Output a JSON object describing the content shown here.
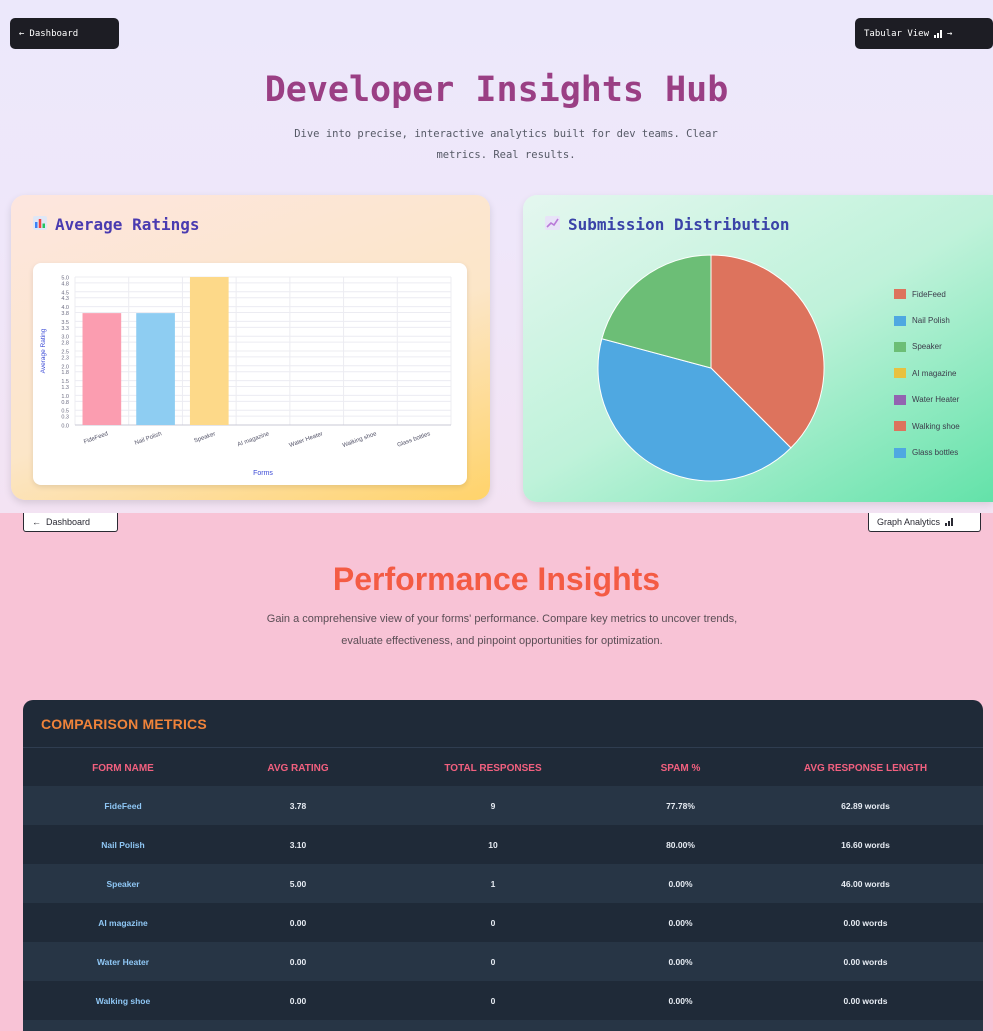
{
  "top": {
    "dashboard_btn": "Dashboard",
    "tabular_btn": "Tabular View",
    "title": "Developer Insights Hub",
    "subtitle": "Dive into precise, interactive analytics built for dev teams. Clear metrics. Real results."
  },
  "ratings_card": {
    "title": "Average Ratings",
    "icon": "bar-chart-icon"
  },
  "dist_card": {
    "title": "Submission Distribution",
    "icon": "trend-chart-icon"
  },
  "chart_data": [
    {
      "type": "bar",
      "categories": [
        "FideFeed",
        "Nail Polish",
        "Speaker",
        "AI magazine",
        "Water Heater",
        "Walking shoe",
        "Glass bottles"
      ],
      "values": [
        3.78,
        3.78,
        5.0,
        0,
        0,
        0,
        0
      ],
      "colors": [
        "#fb9db0",
        "#8ecdf2",
        "#fdd989",
        "#b7a9ee",
        "#9d8cea",
        "#f1a9a0",
        "#9cd4f2"
      ],
      "xlabel": "Forms",
      "ylabel": "Average Rating",
      "ylim": [
        0,
        5.0
      ],
      "yticks": [
        "0.0",
        "0.3",
        "0.5",
        "0.8",
        "1.0",
        "1.3",
        "1.5",
        "1.8",
        "2.0",
        "2.3",
        "2.5",
        "2.8",
        "3.0",
        "3.3",
        "3.5",
        "3.8",
        "4.0",
        "4.3",
        "4.5",
        "4.8",
        "5.0"
      ],
      "grid": true
    },
    {
      "type": "pie",
      "labels": [
        "FideFeed",
        "Nail Polish",
        "Speaker",
        "AI magazine",
        "Water Heater",
        "Walking shoe",
        "Glass bottles"
      ],
      "values": [
        9,
        10,
        5,
        0,
        0,
        0,
        0
      ],
      "colors": [
        "#dd735d",
        "#4fa8e1",
        "#6cbe76",
        "#e8c13f",
        "#9363b1",
        "#dd735d",
        "#4fa8e1"
      ],
      "legend": "right"
    }
  ],
  "bottom": {
    "dashboard_btn": "Dashboard",
    "graph_btn": "Graph Analytics",
    "title": "Performance Insights",
    "subtitle": "Gain a comprehensive view of your forms' performance. Compare key metrics to uncover trends, evaluate effectiveness, and pinpoint opportunities for optimization."
  },
  "metrics": {
    "title": "COMPARISON METRICS",
    "headers": [
      "FORM NAME",
      "AVG RATING",
      "TOTAL RESPONSES",
      "SPAM %",
      "AVG RESPONSE LENGTH"
    ],
    "rows": [
      [
        "FideFeed",
        "3.78",
        "9",
        "77.78%",
        "62.89 words"
      ],
      [
        "Nail Polish",
        "3.10",
        "10",
        "80.00%",
        "16.60 words"
      ],
      [
        "Speaker",
        "5.00",
        "1",
        "0.00%",
        "46.00 words"
      ],
      [
        "AI magazine",
        "0.00",
        "0",
        "0.00%",
        "0.00 words"
      ],
      [
        "Water Heater",
        "0.00",
        "0",
        "0.00%",
        "0.00 words"
      ],
      [
        "Walking shoe",
        "0.00",
        "0",
        "0.00%",
        "0.00 words"
      ],
      [
        "",
        "",
        "",
        "",
        ""
      ]
    ]
  }
}
